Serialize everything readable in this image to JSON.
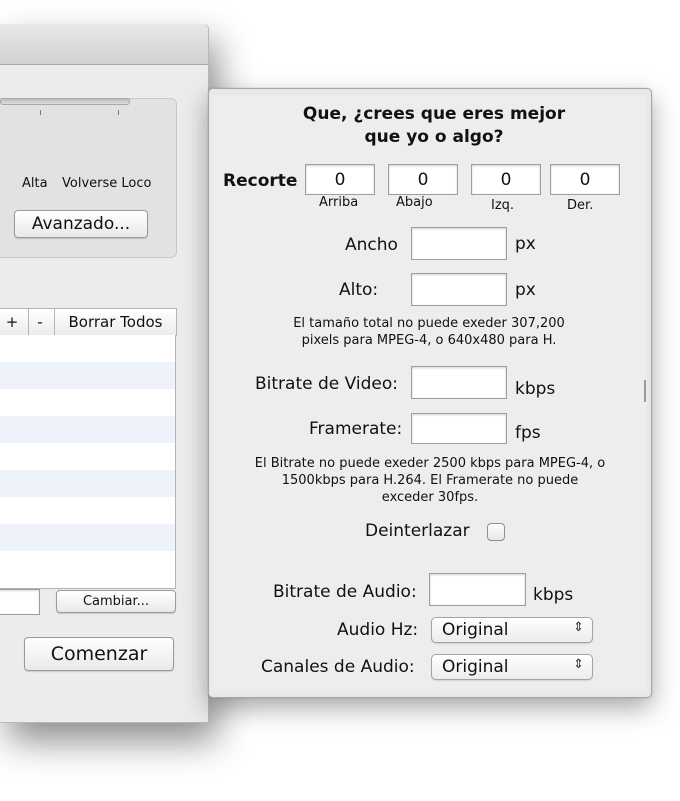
{
  "back_window": {
    "slider_labels": [
      "Alta",
      "Volverse Loco"
    ],
    "advanced_button": "Avanzado...",
    "list_controls": {
      "add": "+",
      "remove": "-",
      "clear_all": "Borrar Todos"
    },
    "change_button": "Cambiar...",
    "start_button": "Comenzar"
  },
  "panel": {
    "title_line1": "Que, ¿crees que eres mejor",
    "title_line2": "que yo o algo?",
    "crop": {
      "label": "Recorte",
      "fields": [
        {
          "value": "0",
          "caption": "Arriba"
        },
        {
          "value": "0",
          "caption": "Abajo"
        },
        {
          "value": "0",
          "caption": "Izq."
        },
        {
          "value": "0",
          "caption": "Der."
        }
      ]
    },
    "width_label": "Ancho",
    "height_label": "Alto:",
    "px_unit": "px",
    "size_note_line1": "El tamaño total no puede exeder 307,200",
    "size_note_line2": "pixels para MPEG-4, o 640x480 para H.",
    "video_bitrate_label": "Bitrate de Video:",
    "kbps_unit": "kbps",
    "framerate_label": "Framerate:",
    "fps_unit": "fps",
    "bitrate_note_line1": "El Bitrate no puede exeder 2500 kbps para MPEG-4, o",
    "bitrate_note_line2": "1500kbps para H.264. El Framerate no puede",
    "bitrate_note_line3": "exceder 30fps.",
    "deinterlace_label": "Deinterlazar",
    "audio_bitrate_label": "Bitrate de Audio:",
    "audio_hz_label": "Audio Hz:",
    "audio_hz_value": "Original",
    "audio_channels_label": "Canales de Audio:",
    "audio_channels_value": "Original",
    "popup_arrows": "⇕"
  }
}
